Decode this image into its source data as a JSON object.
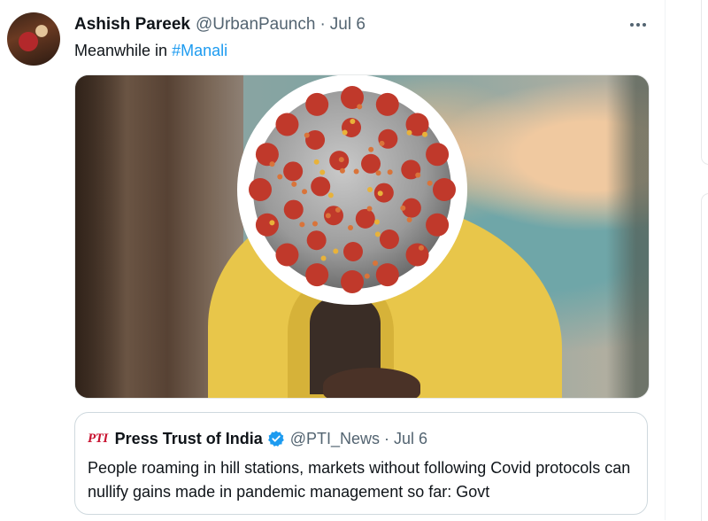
{
  "tweet": {
    "author_name": "Ashish Pareek",
    "author_handle": "@UrbanPaunch",
    "separator": "·",
    "date": "Jul 6",
    "text_prefix": "Meanwhile in ",
    "hashtag": "#Manali",
    "more_icon": "more-horizontal-icon",
    "avatar_icon": "user-avatar"
  },
  "quoted_tweet": {
    "logo_text": "PTI",
    "author_name": "Press Trust of India",
    "verified_icon": "verified-badge-icon",
    "author_handle": "@PTI_News",
    "separator": "·",
    "date": "Jul 6",
    "text": "People roaming in hill stations, markets without following Covid protocols can nullify gains made in pandemic management so far: Govt"
  },
  "colors": {
    "link": "#1d9bf0",
    "secondary_text": "#536471",
    "verified": "#1d9bf0",
    "pti_red": "#c8102e",
    "jacket_yellow": "#e8c64a",
    "virus_spike": "#c0392b"
  }
}
